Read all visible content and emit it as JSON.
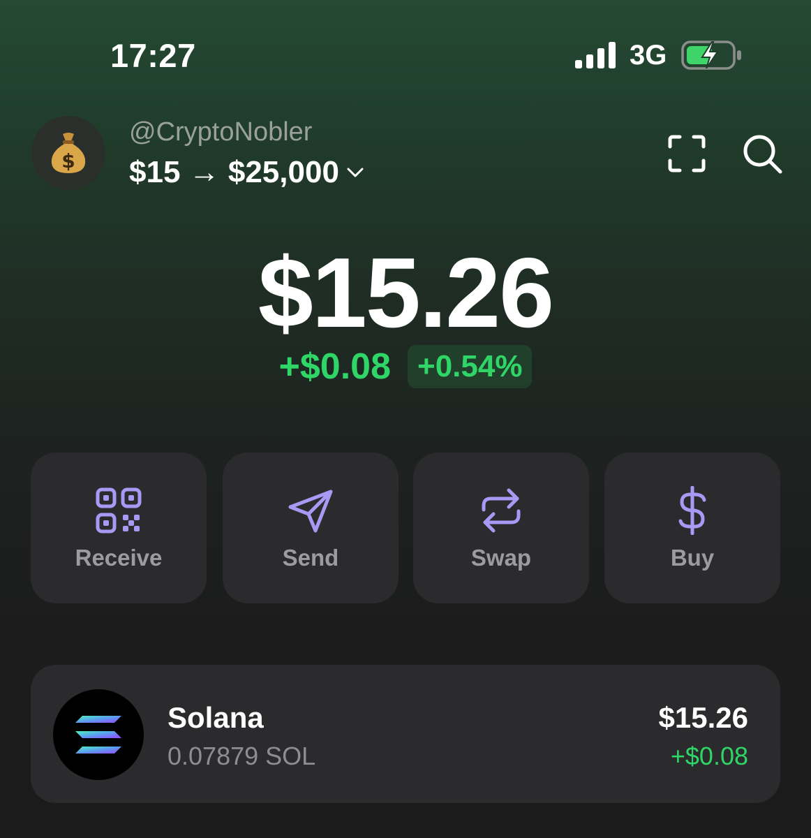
{
  "status_bar": {
    "time": "17:27",
    "network": "3G",
    "signal_bars": 4,
    "battery_charging": true
  },
  "account": {
    "avatar_emoji": "💰",
    "handle": "@CryptoNobler",
    "name": "$15 → $25,000"
  },
  "balance": {
    "total": "$15.26",
    "change_abs": "+$0.08",
    "change_pct": "+0.54%"
  },
  "actions": [
    {
      "label": "Receive",
      "icon": "qr-code-icon"
    },
    {
      "label": "Send",
      "icon": "send-arrow-icon"
    },
    {
      "label": "Swap",
      "icon": "swap-arrows-icon"
    },
    {
      "label": "Buy",
      "icon": "dollar-icon"
    }
  ],
  "tokens": [
    {
      "name": "Solana",
      "amount": "0.07879 SOL",
      "value": "$15.26",
      "change": "+$0.08",
      "icon": "solana-logo-icon"
    }
  ],
  "colors": {
    "accent_purple": "#a999f5",
    "positive_green": "#2fd566",
    "card_bg": "#2b2b2e"
  }
}
